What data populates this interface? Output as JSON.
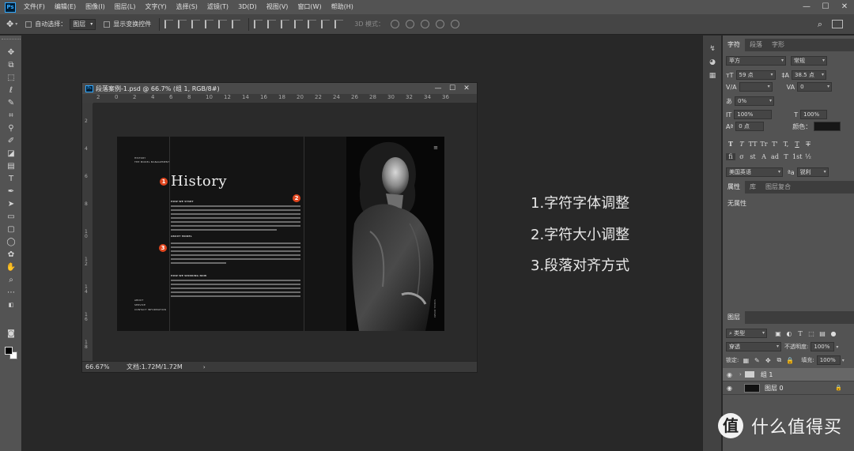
{
  "app": {
    "logo": "Ps",
    "menu": [
      "文件(F)",
      "编辑(E)",
      "图像(I)",
      "图层(L)",
      "文字(Y)",
      "选择(S)",
      "滤镜(T)",
      "3D(D)",
      "视图(V)",
      "窗口(W)",
      "帮助(H)"
    ],
    "window_controls": {
      "minimize": "—",
      "maximize": "☐",
      "close": "✕"
    }
  },
  "options_bar": {
    "auto_select_label": "自动选择：",
    "auto_select_value": "图层",
    "show_transform_label": "显示变换控件",
    "mode_3d_label": "3D 模式："
  },
  "document": {
    "title": "段落案例-1.psd @ 66.7% (组 1, RGB/8#)",
    "ruler_h": [
      "2",
      "0",
      "2",
      "4",
      "6",
      "8",
      "10",
      "12",
      "14",
      "16",
      "18",
      "20",
      "22",
      "24",
      "26",
      "28",
      "30",
      "32",
      "34",
      "36"
    ],
    "ruler_v": [
      "2",
      "4",
      "6",
      "8",
      "10",
      "12",
      "14",
      "16",
      "18"
    ],
    "zoom": "66.67%",
    "doc_size": "文档:1.72M/1.72M"
  },
  "artboard": {
    "heading": "History",
    "top_label_1": "HISTORY",
    "top_label_2": "THE MODEL MANAGEMENT",
    "section_1": "HOW WE START",
    "section_2": "ABOUT MODEL",
    "section_3": "HOW WE WORKING NOW",
    "bottom_label_1": "ABOUT",
    "bottom_label_2": "SERVICE",
    "bottom_label_3": "CONTACT INFORMATION",
    "photo_menu": "≡",
    "photo_vertical": "SCROLL DOWN",
    "markers": [
      "1",
      "2",
      "3"
    ]
  },
  "annotations": [
    "1.字符字体调整",
    "2.字符大小调整",
    "3.段落对齐方式"
  ],
  "character_panel": {
    "tabs": [
      "字符",
      "段落",
      "字形"
    ],
    "font_family": "苹方",
    "font_style": "常规",
    "font_size": "59 点",
    "leading": "38.5 点",
    "kerning": "",
    "tracking": "0",
    "tsume": "0%",
    "vscale": "100%",
    "hscale": "100%",
    "baseline": "0 点",
    "color_label": "颜色：",
    "language": "美国英语",
    "antialias": "锐利",
    "style_buttons": [
      "T",
      "T",
      "TT",
      "Tr",
      "T'",
      "T,",
      "T",
      "T"
    ],
    "opentype_buttons": [
      "fi",
      "σ",
      "st",
      "A",
      "ad",
      "T",
      "1st",
      "½"
    ]
  },
  "properties_panel": {
    "tabs": [
      "属性",
      "库",
      "图层复合"
    ],
    "empty_text": "无属性"
  },
  "layers_panel": {
    "tab": "图层",
    "filter_label": "类型",
    "blend_mode": "穿透",
    "opacity_label": "不透明度:",
    "opacity": "100%",
    "lock_label": "锁定:",
    "fill_label": "填充:",
    "fill": "100%",
    "layers": [
      {
        "name": "组 1",
        "type": "group"
      },
      {
        "name": "图层 0",
        "type": "image"
      }
    ]
  },
  "watermark": {
    "logo": "值",
    "text": "什么值得买"
  },
  "colors": {
    "accent_marker": "#e0451e",
    "ps_blue": "#31a8ff"
  }
}
